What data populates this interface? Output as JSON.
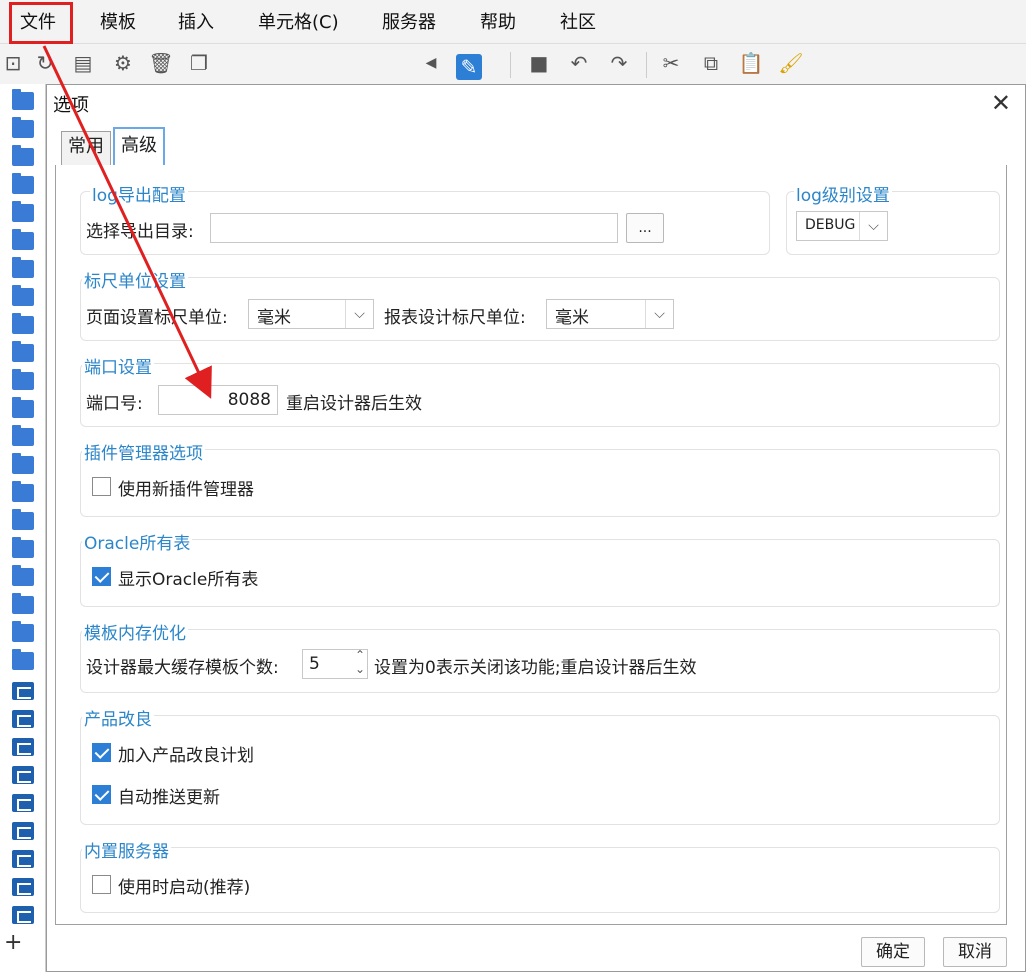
{
  "menubar": {
    "items": [
      "文件",
      "模板",
      "插入",
      "单元格(C)",
      "服务器",
      "帮助",
      "社区"
    ]
  },
  "dialog": {
    "title": "选项",
    "tabs": [
      "常用",
      "高级"
    ],
    "log_export": {
      "title": "log导出配置",
      "dir_label": "选择导出目录:",
      "dir_value": "",
      "browse_label": "..."
    },
    "log_level": {
      "title": "log级别设置",
      "value": "DEBUG"
    },
    "ruler": {
      "title": "标尺单位设置",
      "page_label": "页面设置标尺单位:",
      "page_value": "毫米",
      "report_label": "报表设计标尺单位:",
      "report_value": "毫米"
    },
    "port": {
      "title": "端口设置",
      "label": "端口号:",
      "value": "8088",
      "note": "重启设计器后生效"
    },
    "plugin": {
      "title": "插件管理器选项",
      "option": "使用新插件管理器",
      "checked": false
    },
    "oracle": {
      "title": "Oracle所有表",
      "option": "显示Oracle所有表",
      "checked": true
    },
    "cache": {
      "title": "模板内存优化",
      "label": "设计器最大缓存模板个数:",
      "value": "5",
      "note": "设置为0表示关闭该功能;重启设计器后生效"
    },
    "improve": {
      "title": "产品改良",
      "option1": "加入产品改良计划",
      "option1_checked": true,
      "option2": "自动推送更新",
      "option2_checked": true
    },
    "server": {
      "title": "内置服务器",
      "option": "使用时启动(推荐)",
      "checked": false
    },
    "ok_label": "确定",
    "cancel_label": "取消"
  },
  "colors": {
    "accent": "#2b86c9",
    "highlight": "#e02020"
  }
}
